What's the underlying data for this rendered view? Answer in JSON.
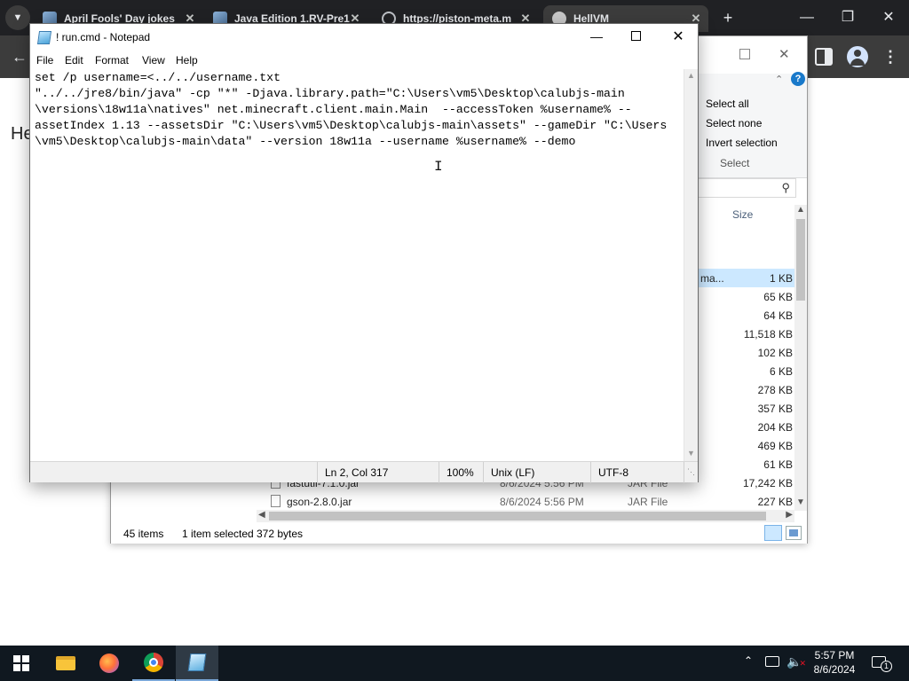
{
  "browser": {
    "tabs": [
      {
        "title": "April Fools' Day jokes"
      },
      {
        "title": "Java Edition 1.RV-Pre1"
      },
      {
        "title": "https://piston-meta.m"
      },
      {
        "title": "HellVM"
      }
    ],
    "new_tab_glyph": "+",
    "page_text_fragment": "He"
  },
  "explorer": {
    "ribbon_select": {
      "select_all": "Select all",
      "select_none": "Select none",
      "invert_selection": "Invert selection",
      "group_label": "Select"
    },
    "column_size": "Size",
    "rows": [
      {
        "name_fragment": "ma...",
        "size": "1 KB",
        "selected": true
      },
      {
        "size": "65 KB"
      },
      {
        "size": "64 KB"
      },
      {
        "size": "11,518 KB"
      },
      {
        "size": "102 KB"
      },
      {
        "size": "6 KB"
      },
      {
        "size": "278 KB"
      },
      {
        "size": "357 KB"
      },
      {
        "size": "204 KB"
      },
      {
        "size": "469 KB"
      },
      {
        "size": "61 KB"
      },
      {
        "name": "fastutil-7.1.0.jar",
        "date": "8/6/2024 5:56 PM",
        "type": "JAR File",
        "size": "17,242 KB"
      },
      {
        "name": "gson-2.8.0.jar",
        "date": "8/6/2024 5:56 PM",
        "type": "JAR File",
        "size": "227 KB"
      }
    ],
    "status": {
      "items": "45 items",
      "selected": "1 item selected",
      "bytes": "372 bytes"
    }
  },
  "notepad": {
    "title": "! run.cmd - Notepad",
    "menu": [
      "File",
      "Edit",
      "Format",
      "View",
      "Help"
    ],
    "lines": [
      "set /p username=<../../username.txt",
      "\"../../jre8/bin/java\" -cp \"*\" -Djava.library.path=\"C:\\Users\\vm5\\Desktop\\calubjs-main",
      "\\versions\\18w11a\\natives\" net.minecraft.client.main.Main  --accessToken %username% --",
      "assetIndex 1.13 --assetsDir \"C:\\Users\\vm5\\Desktop\\calubjs-main\\assets\" --gameDir \"C:\\Users",
      "\\vm5\\Desktop\\calubjs-main\\data\" --version 18w11a --username %username% --demo"
    ],
    "status": {
      "position": "Ln 2, Col 317",
      "zoom": "100%",
      "line_ending": "Unix (LF)",
      "encoding": "UTF-8"
    }
  },
  "taskbar": {
    "time": "5:57 PM",
    "date": "8/6/2024",
    "notification_count": "1"
  }
}
